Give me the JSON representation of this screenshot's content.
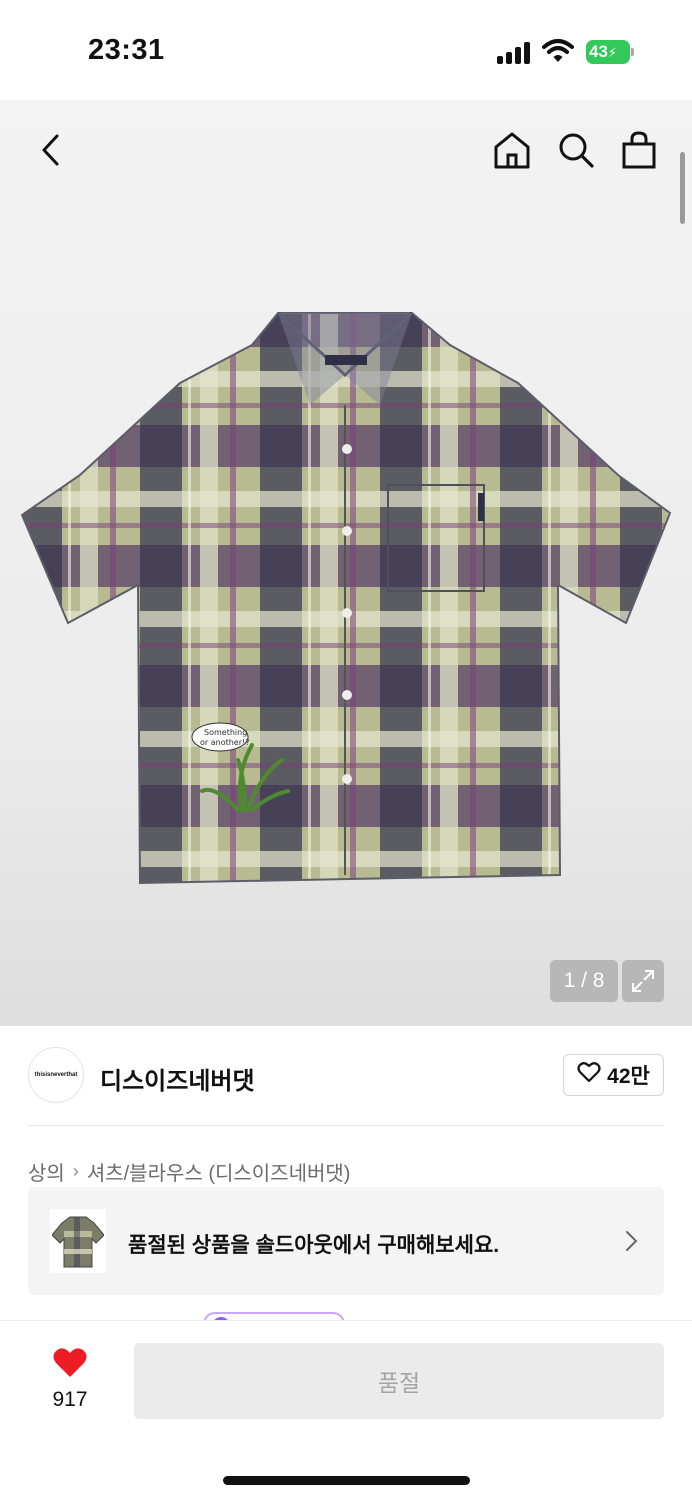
{
  "status_bar": {
    "time": "23:31",
    "battery": "43"
  },
  "header": {
    "icons": [
      "back-arrow-icon",
      "home-icon",
      "search-icon",
      "shopping-bag-icon"
    ]
  },
  "gallery": {
    "counter": "1 / 8",
    "bubble_text_line1": "Something",
    "bubble_text_line2": "or another!?",
    "label_text": "thisisneverthat"
  },
  "brand": {
    "logo_text": "thisisneverthat",
    "name": "디스이즈네버댓",
    "likes": "42만"
  },
  "breadcrumb": {
    "category": "상의",
    "subcategory": "셔츠/블라우스 (디스이즈네버댓)"
  },
  "soldout_banner": {
    "text": "품절된 상품을 솔드아웃에서 구매해보세요."
  },
  "bottom_bar": {
    "wish_count": "917",
    "buy_label": "품절"
  },
  "colors": {
    "heart": "#ee1c25",
    "battery": "#34c759",
    "accent_purple": "#8b5cf6"
  }
}
